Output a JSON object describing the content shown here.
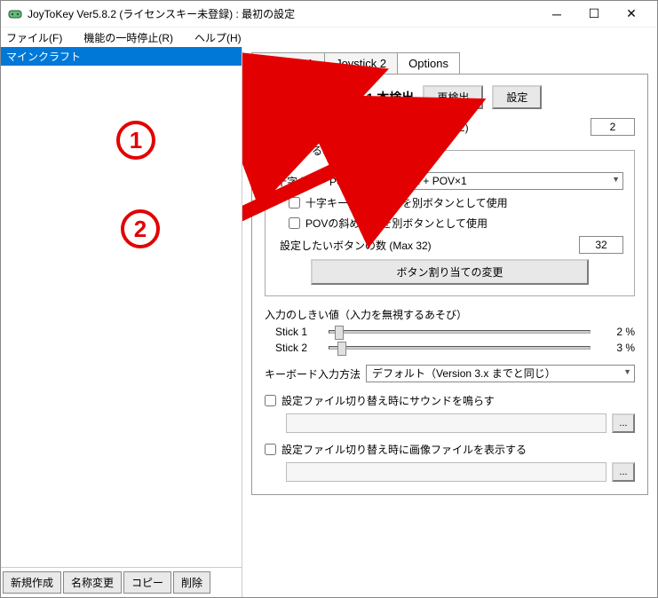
{
  "title": "JoyToKey Ver5.8.2 (ライセンスキー未登録) : 最初の設定",
  "menu": {
    "file": "ファイル(F)",
    "suspend": "機能の一時停止(R)",
    "help": "ヘルプ(H)"
  },
  "profiles": {
    "items": [
      "マインクラフト"
    ]
  },
  "side": {
    "new": "新規作成",
    "rename": "名称変更",
    "copy": "コピー",
    "delete": "削除"
  },
  "tabs": {
    "j1": "Joystick 1",
    "j2": "Joystick 2",
    "opt": "Options"
  },
  "head": {
    "title": "ジョイスティック 1 本検出",
    "redetect": "再検出",
    "settings": "設定"
  },
  "count": {
    "label": "設定したいジョイスティックの数 (Max 32)",
    "value": "2"
  },
  "btnset": {
    "legend": "表示するボタン設定",
    "pov_label": "十字キー・POV",
    "pov_value": "十字キー×2 + POV×1",
    "diag1": "十字キーの斜め入力を別ボタンとして使用",
    "diag2": "POVの斜め入力を別ボタンとして使用",
    "btncnt_label": "設定したいボタンの数 (Max 32)",
    "btncnt_value": "32",
    "assign_btn": "ボタン割り当ての変更"
  },
  "thresh": {
    "label": "入力のしきい値（入力を無視するあそび）",
    "s1": "Stick 1",
    "s1v": "2 %",
    "s2": "Stick 2",
    "s2v": "3 %"
  },
  "kb": {
    "label": "キーボード入力方法",
    "value": "デフォルト（Version 3.x までと同じ）"
  },
  "sound": {
    "label": "設定ファイル切り替え時にサウンドを鳴らす"
  },
  "image": {
    "label": "設定ファイル切り替え時に画像ファイルを表示する"
  },
  "annot": {
    "one": "1",
    "two": "2"
  }
}
